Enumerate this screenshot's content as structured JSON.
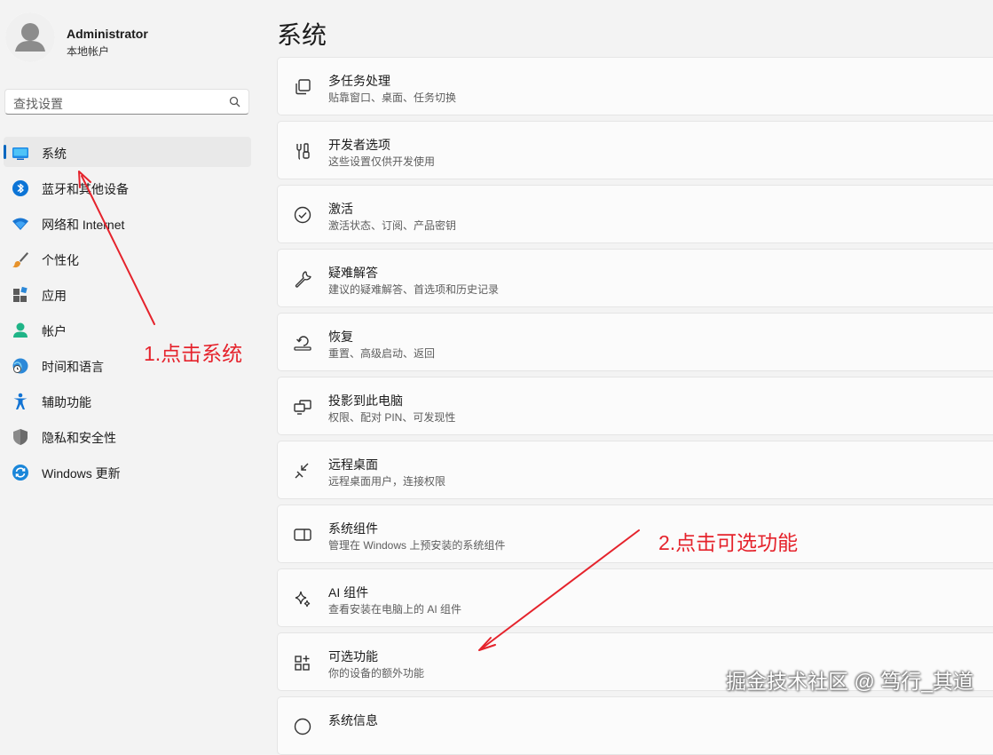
{
  "user": {
    "name": "Administrator",
    "account_type": "本地帐户"
  },
  "search": {
    "placeholder": "查找设置"
  },
  "sidebar": {
    "items": [
      {
        "label": "系统",
        "icon": "system-icon",
        "active": true
      },
      {
        "label": "蓝牙和其他设备",
        "icon": "bluetooth-icon"
      },
      {
        "label": "网络和 Internet",
        "icon": "wifi-icon"
      },
      {
        "label": "个性化",
        "icon": "brush-icon"
      },
      {
        "label": "应用",
        "icon": "apps-icon"
      },
      {
        "label": "帐户",
        "icon": "account-icon"
      },
      {
        "label": "时间和语言",
        "icon": "time-language-icon"
      },
      {
        "label": "辅助功能",
        "icon": "accessibility-icon"
      },
      {
        "label": "隐私和安全性",
        "icon": "shield-icon"
      },
      {
        "label": "Windows 更新",
        "icon": "update-icon"
      }
    ]
  },
  "main": {
    "title": "系统",
    "cards": [
      {
        "title": "多任务处理",
        "description": "贴靠窗口、桌面、任务切换",
        "icon": "multitasking-icon"
      },
      {
        "title": "开发者选项",
        "description": "这些设置仅供开发使用",
        "icon": "developer-icon"
      },
      {
        "title": "激活",
        "description": "激活状态、订阅、产品密钥",
        "icon": "activation-icon"
      },
      {
        "title": "疑难解答",
        "description": "建议的疑难解答、首选项和历史记录",
        "icon": "wrench-icon"
      },
      {
        "title": "恢复",
        "description": "重置、高级启动、返回",
        "icon": "recovery-icon"
      },
      {
        "title": "投影到此电脑",
        "description": "权限、配对 PIN、可发现性",
        "icon": "project-icon"
      },
      {
        "title": "远程桌面",
        "description": "远程桌面用户，连接权限",
        "icon": "remote-desktop-icon"
      },
      {
        "title": "系统组件",
        "description": "管理在 Windows 上预安装的系统组件",
        "icon": "system-components-icon"
      },
      {
        "title": "AI 组件",
        "description": "查看安装在电脑上的 AI 组件",
        "icon": "sparkle-icon"
      },
      {
        "title": "可选功能",
        "description": "你的设备的额外功能",
        "icon": "optional-features-icon"
      },
      {
        "title": "系统信息",
        "description": "",
        "icon": "info-icon"
      }
    ]
  },
  "annotations": {
    "step1": "1.点击系统",
    "step2": "2.点击可选功能"
  },
  "watermark": "掘金技术社区 @ 笃行_其道",
  "colors": {
    "accent": "#0067c0",
    "annotation": "#e5232c"
  }
}
